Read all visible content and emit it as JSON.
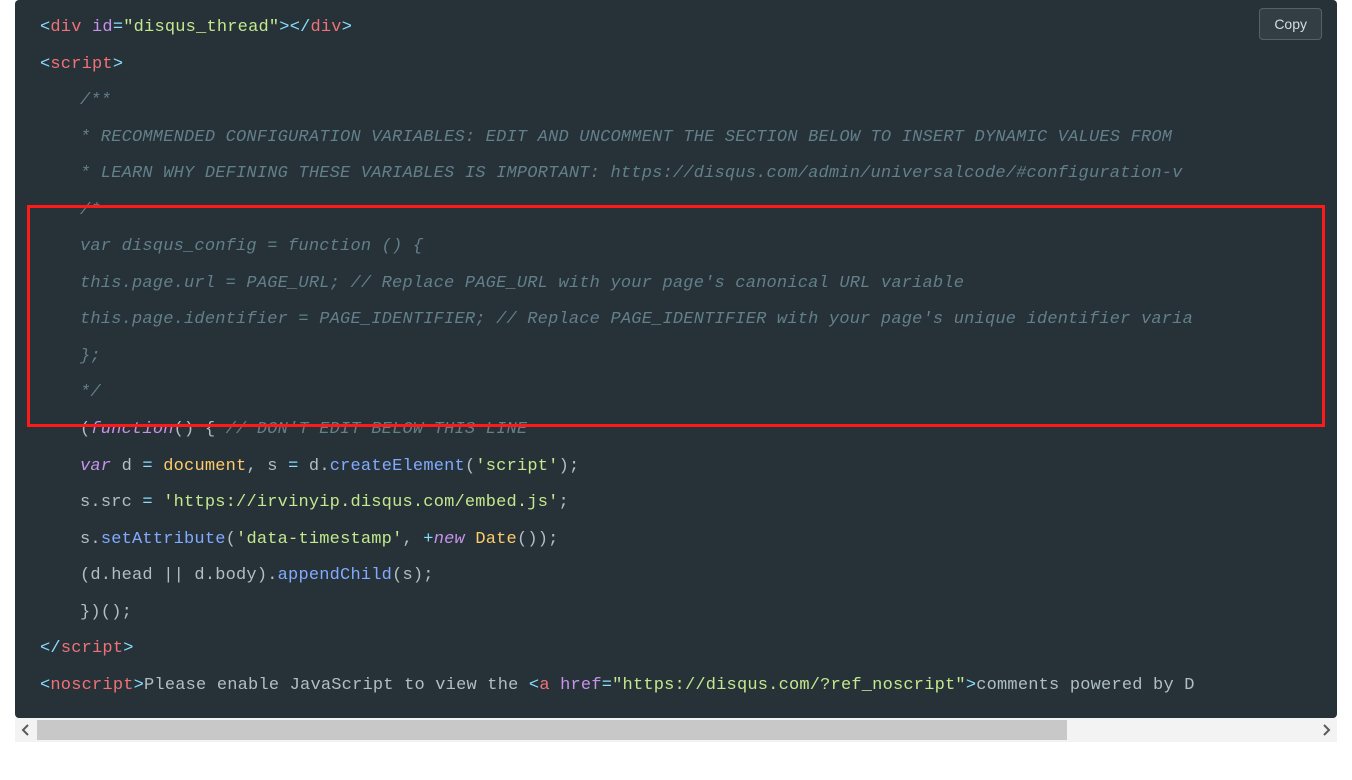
{
  "copy_button_label": "Copy",
  "tokens": {
    "lt": "<",
    "gt": ">",
    "slash": "/",
    "eq": "=",
    "div": "div",
    "id_attr": "id",
    "disqus_thread_str": "\"disqus_thread\"",
    "script_tag": "script",
    "noscript_tag": "noscript",
    "a_tag": "a",
    "href_attr": "href",
    "var_kw": "var",
    "function_kw": "function",
    "new_kw": "new",
    "document_obj": "document",
    "date_obj": "Date",
    "createElement": "createElement",
    "setAttribute": "setAttribute",
    "appendChild": "appendChild",
    "head_prop": "head",
    "body_prop": "body",
    "src_prop": "src",
    "d_var": "d",
    "s_var": "s",
    "script_str": "'script'",
    "embed_url_str": "'https://irvinyip.disqus.com/embed.js'",
    "dt_str": "'data-timestamp'",
    "noscript_href": "\"https://disqus.com/?ref_noscript\"",
    "noscript_text_pre": "Please enable JavaScript to view the ",
    "noscript_text_post": "comments powered by D",
    "paren_group_dont_edit": "// DON'T EDIT BELOW THIS LINE"
  },
  "comments": {
    "l1": "/**",
    "l2": "*  RECOMMENDED CONFIGURATION VARIABLES: EDIT AND UNCOMMENT THE SECTION BELOW TO INSERT DYNAMIC VALUES FROM ",
    "l3": "*  LEARN WHY DEFINING THESE VARIABLES IS IMPORTANT: https://disqus.com/admin/universalcode/#configuration-v",
    "l4": "/*",
    "l5": "var disqus_config = function () {",
    "l6": "this.page.url = PAGE_URL;  // Replace PAGE_URL with your page's canonical URL variable",
    "l7": "this.page.identifier = PAGE_IDENTIFIER; // Replace PAGE_IDENTIFIER with your page's unique identifier varia",
    "l8": "};",
    "l9": "*/"
  },
  "plain": {
    "open_paren": "(",
    "close_paren_block": "() {",
    "close_brace": "})();",
    "semi": ";",
    "comma_sp": ", ",
    "eq_sp": " = ",
    "dot": ".",
    "plus": "+",
    "dpipe": " || ",
    "open_p2": "(",
    "close_p2": ")",
    "open_p3": "()",
    "head_body_expr": "(d.head || d.body)."
  }
}
